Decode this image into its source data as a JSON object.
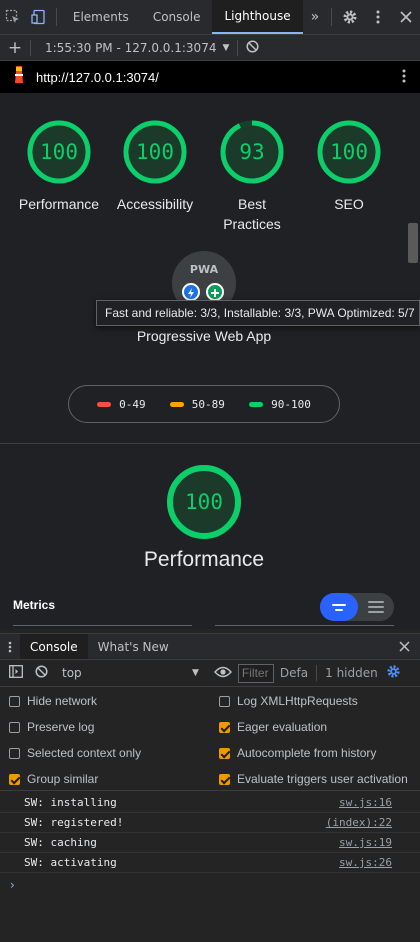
{
  "devtools": {
    "tabs": [
      {
        "label": "Elements"
      },
      {
        "label": "Console"
      },
      {
        "label": "Lighthouse"
      }
    ],
    "more_label": "»"
  },
  "lighthouse_toolbar": {
    "plus_label": "+",
    "report_selector": "1:55:30 PM - 127.0.0.1:3074"
  },
  "url_bar": {
    "url": "http://127.0.0.1:3074/"
  },
  "scores": [
    {
      "value": "100",
      "label": "Performance",
      "fraction": 1.0
    },
    {
      "value": "100",
      "label": "Accessibility",
      "fraction": 1.0
    },
    {
      "value": "93",
      "label": "Best Practices",
      "fraction": 0.93
    },
    {
      "value": "100",
      "label": "SEO",
      "fraction": 1.0
    }
  ],
  "pwa": {
    "badge_text": "PWA",
    "tooltip": "Fast and reliable: 3/3, Installable: 3/3, PWA Optimized: 5/7",
    "label": "Progressive Web App"
  },
  "legend": [
    {
      "range": "0-49",
      "color": "#ff4e42"
    },
    {
      "range": "50-89",
      "color": "#ffa400"
    },
    {
      "range": "90-100",
      "color": "#0cce6b"
    }
  ],
  "performance_section": {
    "score": "100",
    "score_fraction": 1.0,
    "title": "Performance",
    "metrics_label": "Metrics"
  },
  "drawer": {
    "tabs": [
      {
        "label": "Console"
      },
      {
        "label": "What's New"
      }
    ]
  },
  "console_toolbar": {
    "context": "top",
    "filter_placeholder": "Filter",
    "levels_label": "Defa",
    "hidden_count": "1 hidden"
  },
  "console_settings": {
    "left": [
      {
        "label": "Hide network",
        "checked": false
      },
      {
        "label": "Preserve log",
        "checked": false
      },
      {
        "label": "Selected context only",
        "checked": false
      },
      {
        "label": "Group similar",
        "checked": true
      }
    ],
    "right": [
      {
        "label": "Log XMLHttpRequests",
        "checked": false
      },
      {
        "label": "Eager evaluation",
        "checked": true
      },
      {
        "label": "Autocomplete from history",
        "checked": true
      },
      {
        "label": "Evaluate triggers user activation",
        "checked": true
      }
    ]
  },
  "console_log": [
    {
      "message": "SW: installing",
      "source": "sw.js:16"
    },
    {
      "message": "SW: registered!",
      "source": "(index):22"
    },
    {
      "message": "SW: caching",
      "source": "sw.js:19"
    },
    {
      "message": "SW: activating",
      "source": "sw.js:26"
    }
  ],
  "colors": {
    "pass": "#0cce6b",
    "accent": "#2962ff",
    "checkbox": "#f29900"
  },
  "icons": [
    "inspect-icon",
    "device-toolbar-icon",
    "gear-icon",
    "kebab-menu-icon",
    "close-icon",
    "clear-icon",
    "lighthouse-icon",
    "sidebar-icon",
    "eye-icon"
  ]
}
